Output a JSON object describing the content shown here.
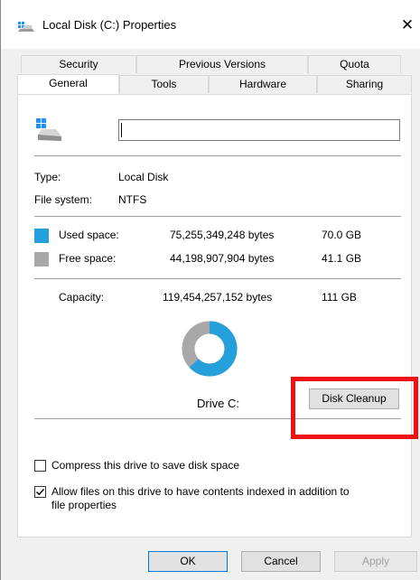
{
  "window": {
    "title": "Local Disk (C:) Properties",
    "close_glyph": "✕"
  },
  "tabs": {
    "row1": [
      "Security",
      "Previous Versions",
      "Quota"
    ],
    "row2": [
      "General",
      "Tools",
      "Hardware",
      "Sharing"
    ],
    "active": "General"
  },
  "general": {
    "name_value": "",
    "type_label": "Type:",
    "type_value": "Local Disk",
    "fs_label": "File system:",
    "fs_value": "NTFS",
    "used": {
      "label": "Used space:",
      "bytes": "75,255,349,248 bytes",
      "size": "70.0 GB",
      "color": "#26a0da"
    },
    "free": {
      "label": "Free space:",
      "bytes": "44,198,907,904 bytes",
      "size": "41.1 GB",
      "color": "#a8a8a8"
    },
    "capacity": {
      "label": "Capacity:",
      "bytes": "119,454,257,152 bytes",
      "size": "111 GB"
    },
    "used_fraction": 0.63,
    "drive_label": "Drive C:",
    "disk_cleanup_label": "Disk Cleanup",
    "compress_label": "Compress this drive to save disk space",
    "compress_checked": false,
    "index_label_line1": "Allow files on this drive to have contents indexed in addition to",
    "index_label_line2": "file properties",
    "index_checked": true
  },
  "buttons": {
    "ok": "OK",
    "cancel": "Cancel",
    "apply": "Apply"
  },
  "icons": {
    "title": "drive-icon",
    "drive": "drive-icon",
    "close": "close-icon"
  },
  "colors": {
    "highlight": "#ee1111",
    "accent": "#0078d7"
  }
}
